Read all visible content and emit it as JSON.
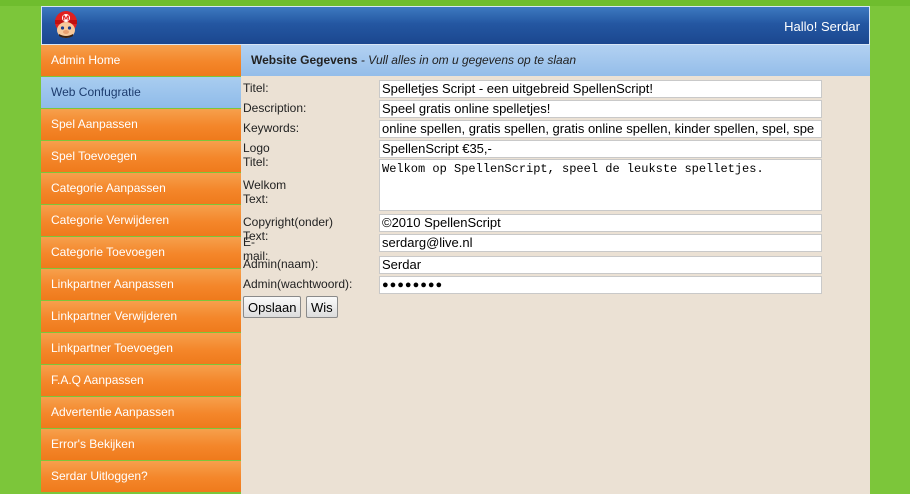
{
  "header": {
    "greeting": "Hallo! Serdar"
  },
  "sidebar": {
    "items": [
      {
        "label": "Admin Home",
        "active": false
      },
      {
        "label": "Web Confugratie",
        "active": true
      },
      {
        "label": "Spel Aanpassen",
        "active": false
      },
      {
        "label": "Spel Toevoegen",
        "active": false
      },
      {
        "label": "Categorie Aanpassen",
        "active": false
      },
      {
        "label": "Categorie Verwijderen",
        "active": false
      },
      {
        "label": "Categorie Toevoegen",
        "active": false
      },
      {
        "label": "Linkpartner Aanpassen",
        "active": false
      },
      {
        "label": "Linkpartner Verwijderen",
        "active": false
      },
      {
        "label": "Linkpartner Toevoegen",
        "active": false
      },
      {
        "label": "F.A.Q Aanpassen",
        "active": false
      },
      {
        "label": "Advertentie Aanpassen",
        "active": false
      },
      {
        "label": "Error's Bekijken",
        "active": false
      },
      {
        "label": "Serdar Uitloggen?",
        "active": false
      }
    ]
  },
  "content": {
    "title": "Website Gegevens",
    "subtitle": " - Vull alles in om u gegevens op te slaan"
  },
  "form": {
    "titel": {
      "label": "Titel:",
      "value": "Spelletjes Script - een uitgebreid SpellenScript!"
    },
    "description": {
      "label": "Description:",
      "value": "Speel gratis online spelletjes!"
    },
    "keywords": {
      "label": "Keywords:",
      "value": "online spellen, gratis spellen, gratis online spellen, kinder spellen, spel, spe"
    },
    "logo_titel": {
      "label": "Logo Titel:",
      "value": "SpellenScript €35,-"
    },
    "welkom": {
      "label": "Welkom Text:",
      "value": "Welkom op SpellenScript, speel de leukste spelletjes."
    },
    "copyright": {
      "label": "Copyright(onder) Text:",
      "value": "©2010 SpellenScript"
    },
    "email": {
      "label": "E-mail:",
      "value": "serdarg@live.nl"
    },
    "admin_naam": {
      "label": "Admin(naam):",
      "value": "Serdar"
    },
    "admin_wachtwoord": {
      "label": "Admin(wachtwoord):",
      "value": "●●●●●●●●"
    }
  },
  "buttons": {
    "save": "Opslaan",
    "clear": "Wis"
  },
  "colors": {
    "background": "#7cc63a",
    "nav_orange": "#f4862a",
    "nav_active": "#8fbbe9",
    "header_blue": "#2457a2",
    "content_bg": "#ebe1d4"
  }
}
